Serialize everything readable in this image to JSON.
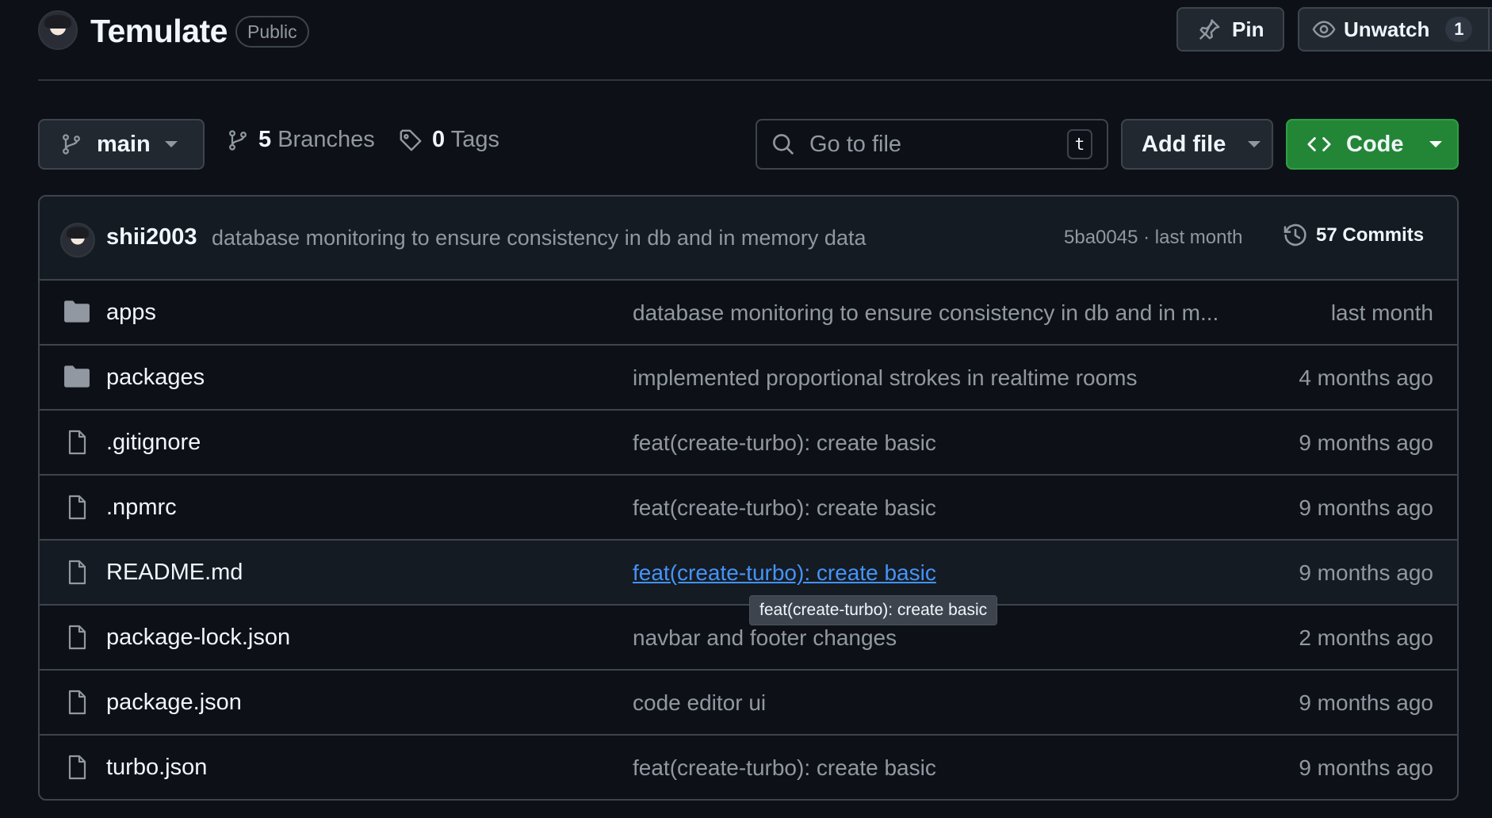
{
  "repo": {
    "name": "Temulate",
    "visibility": "Public"
  },
  "actions": {
    "pin_label": "Pin",
    "watch_label": "Unwatch",
    "watch_count": "1"
  },
  "toolbar": {
    "branch": "main",
    "branches_count": "5",
    "branches_label": "Branches",
    "tags_count": "0",
    "tags_label": "Tags",
    "search_placeholder": "Go to file",
    "search_shortcut": "t",
    "add_file_label": "Add file",
    "code_label": "Code"
  },
  "latest_commit": {
    "author": "shii2003",
    "message": "database monitoring to ensure consistency in db and in memory data",
    "meta": "5ba0045 · last month",
    "commits_label": "57 Commits"
  },
  "files": [
    {
      "type": "folder",
      "name": "apps",
      "commit": "database monitoring to ensure consistency in db and in m...",
      "time": "last month"
    },
    {
      "type": "folder",
      "name": "packages",
      "commit": "implemented proportional strokes in realtime rooms",
      "time": "4 months ago"
    },
    {
      "type": "file",
      "name": ".gitignore",
      "commit": "feat(create-turbo): create basic",
      "time": "9 months ago"
    },
    {
      "type": "file",
      "name": ".npmrc",
      "commit": "feat(create-turbo): create basic",
      "time": "9 months ago"
    },
    {
      "type": "file",
      "name": "README.md",
      "commit": "feat(create-turbo): create basic",
      "time": "9 months ago"
    },
    {
      "type": "file",
      "name": "package-lock.json",
      "commit": "navbar and footer changes",
      "time": "2 months ago"
    },
    {
      "type": "file",
      "name": "package.json",
      "commit": "code editor ui",
      "time": "9 months ago"
    },
    {
      "type": "file",
      "name": "turbo.json",
      "commit": "feat(create-turbo): create basic",
      "time": "9 months ago"
    }
  ],
  "tooltip": "feat(create-turbo): create basic",
  "icons": {
    "folder": "folder-icon",
    "file": "file-icon"
  },
  "colors": {
    "background": "#0d1117",
    "code_button": "#238636",
    "link": "#4493f8",
    "muted_text": "#9198a1"
  }
}
